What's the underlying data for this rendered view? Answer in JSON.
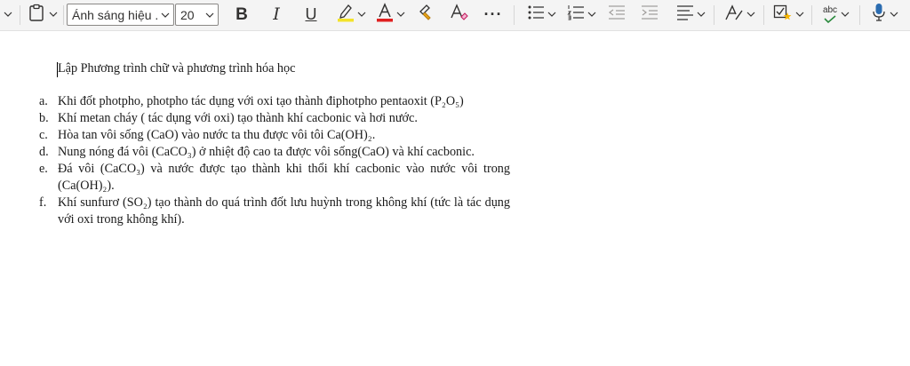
{
  "toolbar": {
    "font_name": "Ánh sáng hiệu ...",
    "font_size": "20",
    "bold": "B",
    "italic": "I",
    "underline": "U",
    "more": "···",
    "spell": "abc",
    "highlight_color": "#f3e32a",
    "font_color": "#e02020",
    "accent_blue": "#2b6cb0"
  },
  "document": {
    "title": "Lập Phương trình chữ và phương trình hóa học",
    "items": [
      {
        "marker": "a.",
        "text": "Khi đốt photpho, photpho tác dụng với oxi tạo thành điphotpho pentaoxit (P₂O₅)"
      },
      {
        "marker": "b.",
        "text": "Khí metan cháy ( tác dụng với oxi) tạo thành khí cacbonic và hơi nước."
      },
      {
        "marker": "c.",
        "text": "Hòa tan vôi sống (CaO) vào nước ta thu được vôi tôi Ca(OH)₂."
      },
      {
        "marker": "d.",
        "text": "Nung nóng đá vôi (CaCO₃) ở nhiệt độ cao ta được vôi sống(CaO)  và khí cacbonic."
      },
      {
        "marker": "e.",
        "text": "Đá vôi (CaCO₃) và nước được tạo thành khi thổi khí cacbonic vào nước vôi trong (Ca(OH)₂)."
      },
      {
        "marker": "f.",
        "text": "Khí sunfurơ (SO₂) tạo thành do quá trình đốt lưu huỳnh trong không khí (tức là tác dụng với oxi trong không khí)."
      }
    ]
  }
}
